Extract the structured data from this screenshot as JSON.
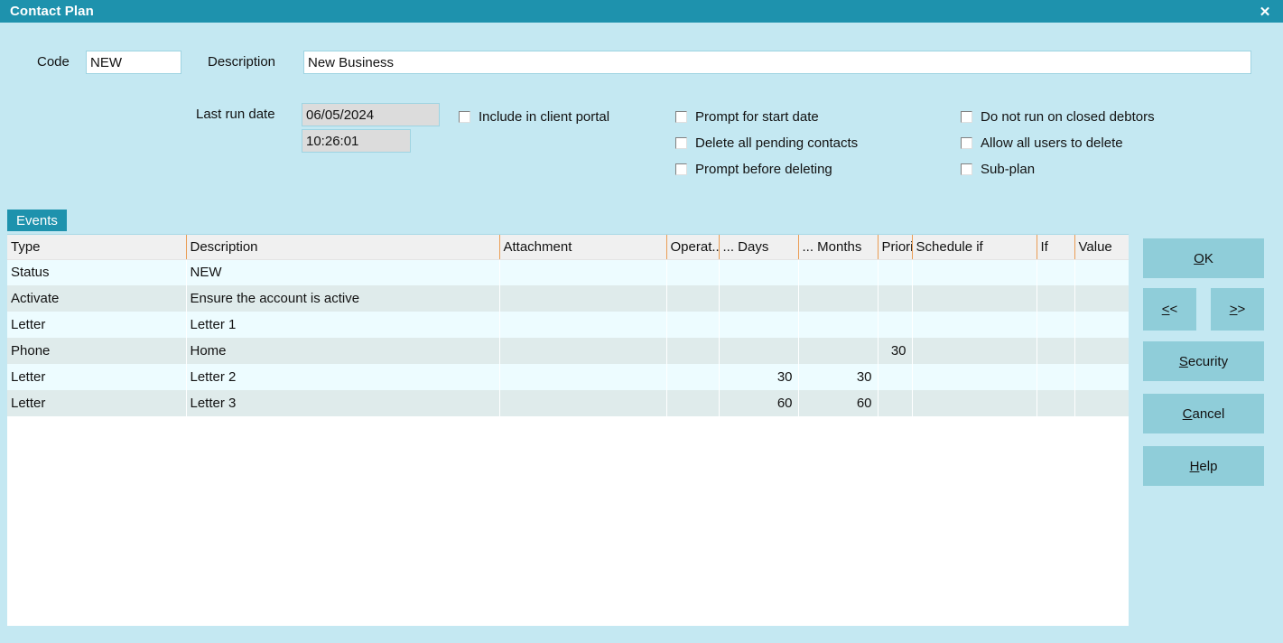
{
  "window": {
    "title": "Contact Plan",
    "close_label": "✕"
  },
  "form": {
    "code_label": "Code",
    "code_value": "NEW",
    "description_label": "Description",
    "description_value": "New Business",
    "last_run_label": "Last run date",
    "last_run_date": "06/05/2024",
    "last_run_time": "10:26:01"
  },
  "checkboxes": [
    {
      "label": "Include in client portal",
      "checked": false
    },
    {
      "label": "Prompt for start date",
      "checked": false
    },
    {
      "label": "Delete all pending contacts",
      "checked": false
    },
    {
      "label": "Prompt before deleting",
      "checked": false
    },
    {
      "label": "Do not run on closed debtors",
      "checked": false
    },
    {
      "label": "Allow all users to delete",
      "checked": false
    },
    {
      "label": "Sub-plan",
      "checked": false
    }
  ],
  "tabs": [
    {
      "label": "Events",
      "active": true
    }
  ],
  "grid": {
    "columns": [
      "Type",
      "Description",
      "Attachment",
      "Operat...",
      "... Days",
      "... Months",
      "Priori",
      "Schedule if",
      "If",
      "Value"
    ],
    "rows": [
      {
        "type": "Status",
        "description": "NEW",
        "attachment": "",
        "operator": "",
        "days": "",
        "months": "",
        "priority": "",
        "schedule_if": "",
        "if": "",
        "value": ""
      },
      {
        "type": "Activate",
        "description": "Ensure the account is active",
        "attachment": "",
        "operator": "",
        "days": "",
        "months": "",
        "priority": "",
        "schedule_if": "",
        "if": "",
        "value": ""
      },
      {
        "type": "Letter",
        "description": "Letter 1",
        "attachment": "",
        "operator": "",
        "days": "",
        "months": "",
        "priority": "",
        "schedule_if": "",
        "if": "",
        "value": ""
      },
      {
        "type": "Phone",
        "description": "Home",
        "attachment": "",
        "operator": "",
        "days": "",
        "months": "",
        "priority": "30",
        "schedule_if": "",
        "if": "",
        "value": ""
      },
      {
        "type": "Letter",
        "description": "Letter 2",
        "attachment": "",
        "operator": "",
        "days": "30",
        "months": "30",
        "priority": "",
        "schedule_if": "",
        "if": "",
        "value": ""
      },
      {
        "type": "Letter",
        "description": "Letter 3",
        "attachment": "",
        "operator": "",
        "days": "60",
        "months": "60",
        "priority": "",
        "schedule_if": "",
        "if": "",
        "value": ""
      }
    ]
  },
  "buttons": {
    "ok": "OK",
    "prev": "<<",
    "next": ">>",
    "security": "Security",
    "cancel": "Cancel",
    "help": "Help"
  },
  "colors": {
    "titlebar": "#1e92ad",
    "background": "#c4e8f2",
    "button": "#8fcdd9",
    "row_odd": "#edfcff",
    "row_even": "#dfebeb",
    "header": "#f0f0f0"
  }
}
